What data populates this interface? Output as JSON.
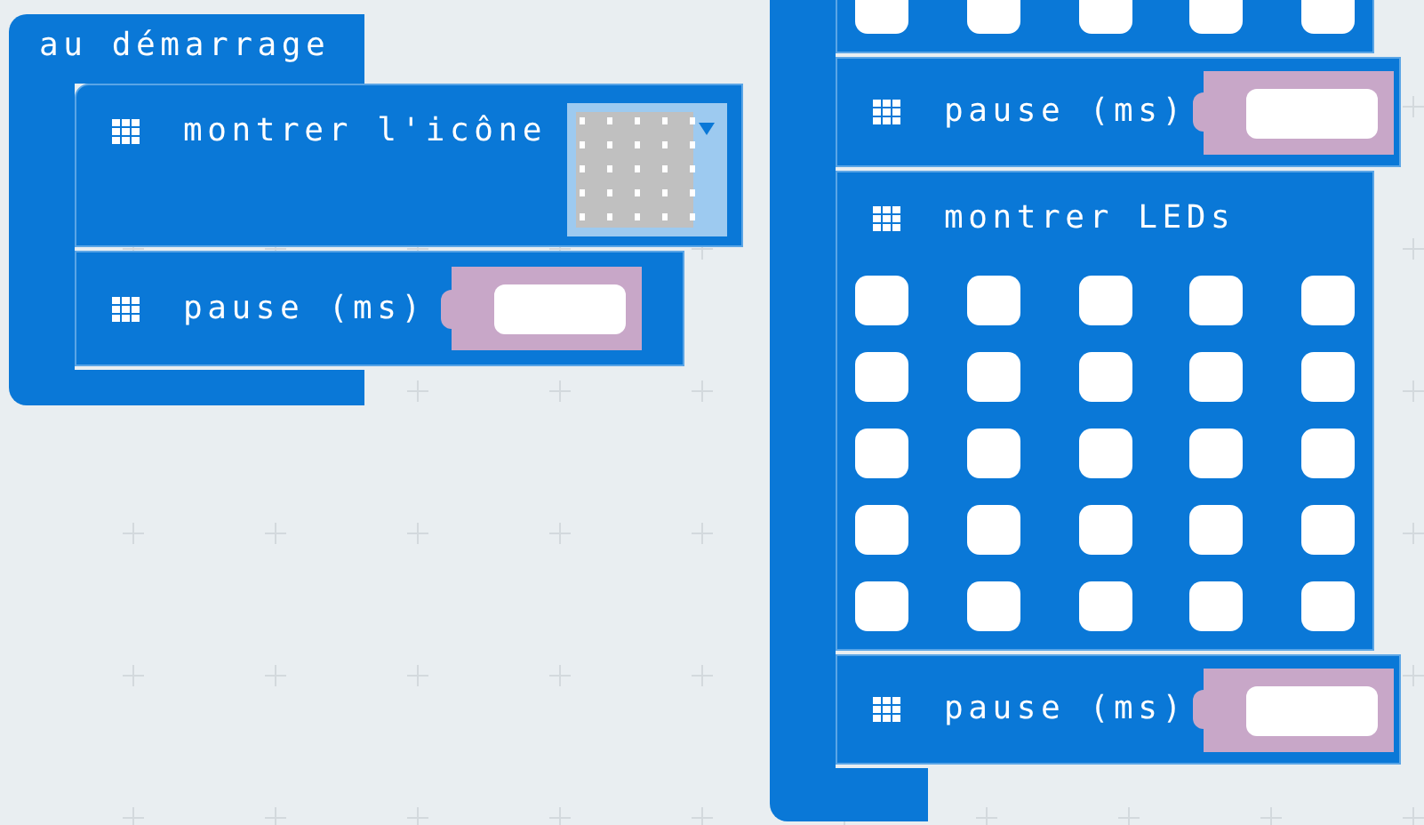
{
  "stacks": [
    {
      "kind": "event",
      "label": "au démarrage",
      "body": [
        {
          "kind": "show_icon",
          "label": "montrer l'icône"
        },
        {
          "kind": "pause",
          "label": "pause (ms)"
        }
      ]
    },
    {
      "kind": "stack",
      "body": [
        {
          "kind": "show_leds",
          "leds": [
            [
              {
                "on": false
              },
              {
                "on": false
              },
              {
                "on": false
              },
              {
                "on": false
              },
              {
                "on": false
              }
            ]
          ]
        },
        {
          "kind": "pause",
          "label": "pause (ms)"
        },
        {
          "kind": "show_leds",
          "label": "montrer LEDs",
          "leds": [
            [
              {
                "on": false
              },
              {
                "on": false
              },
              {
                "on": false
              },
              {
                "on": false
              },
              {
                "on": false
              }
            ],
            [
              {
                "on": false
              },
              {
                "on": false
              },
              {
                "on": false
              },
              {
                "on": false
              },
              {
                "on": false
              }
            ],
            [
              {
                "on": false
              },
              {
                "on": false
              },
              {
                "on": false
              },
              {
                "on": false
              },
              {
                "on": false
              }
            ],
            [
              {
                "on": false
              },
              {
                "on": false
              },
              {
                "on": false
              },
              {
                "on": false
              },
              {
                "on": false
              }
            ],
            [
              {
                "on": false
              },
              {
                "on": false
              },
              {
                "on": false
              },
              {
                "on": false
              },
              {
                "on": false
              }
            ]
          ]
        },
        {
          "kind": "pause",
          "label": "pause (ms)"
        }
      ]
    }
  ]
}
